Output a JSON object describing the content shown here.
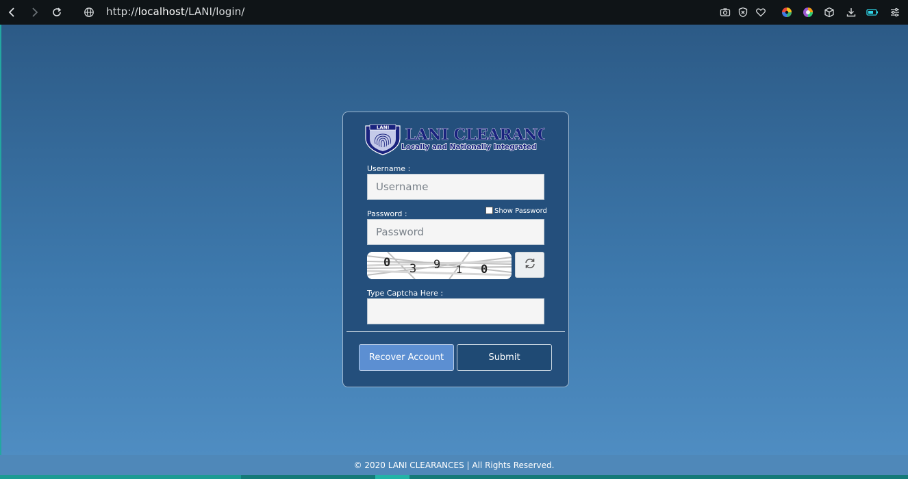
{
  "browser": {
    "url_prefix": "http://",
    "url_host": "localhost",
    "url_path": "/LANI/login/"
  },
  "brand": {
    "name": "LANI CLEARANCES",
    "tagline": "Locally and Nationally Integrated",
    "shield_text": "LANI"
  },
  "form": {
    "username_label": "Username :",
    "username_placeholder": "Username",
    "password_label": "Password :",
    "password_placeholder": "Password",
    "show_password_label": "Show Password",
    "captcha_code": [
      "0",
      "3",
      "9",
      "1",
      "0"
    ],
    "captcha_label": "Type Captcha Here :",
    "captcha_value": ""
  },
  "buttons": {
    "recover": "Recover Account",
    "submit": "Submit"
  },
  "footer": {
    "text": "© 2020 LANI CLEARANCES | All Rights Reserved."
  }
}
